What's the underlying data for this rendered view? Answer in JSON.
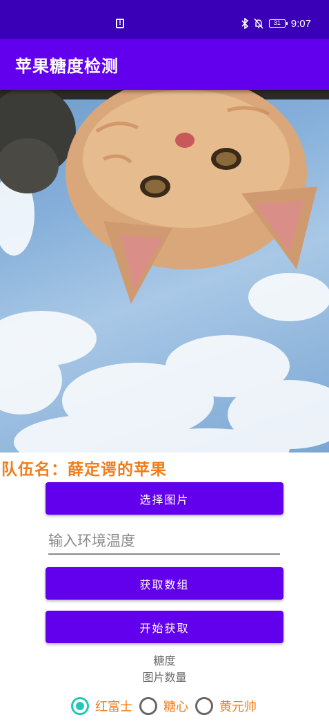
{
  "status_bar": {
    "time": "9:07",
    "battery": "31",
    "icons": [
      "notification-icon",
      "bluetooth-icon",
      "mute-icon",
      "battery-icon"
    ]
  },
  "app_bar": {
    "title": "苹果糖度检测"
  },
  "photo": {
    "subject": "cat-photo"
  },
  "team": {
    "name": "队伍名：薛定谔的苹果"
  },
  "buttons": {
    "select_image": "选择图片",
    "get_array": "获取数组",
    "start_fetch": "开始获取"
  },
  "temperature_input": {
    "value": "",
    "placeholder": "输入环境温度"
  },
  "info": {
    "sugar": "糖度",
    "image_count": "图片数量"
  },
  "varieties": [
    {
      "label": "红富士",
      "checked": true
    },
    {
      "label": "糖心",
      "checked": false
    },
    {
      "label": "黄元帅",
      "checked": false
    }
  ],
  "colors": {
    "status_bar": "#3a00b8",
    "primary": "#6200ee",
    "accent_orange": "#f07d1a",
    "radio_checked": "#1fc9b5"
  }
}
